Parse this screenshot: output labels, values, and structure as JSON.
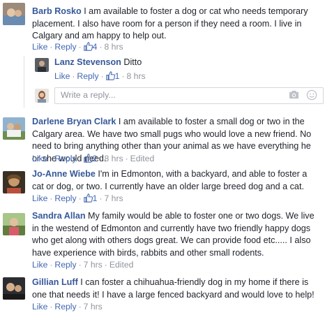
{
  "comments": [
    {
      "author": "Barb Rosko",
      "text": "I am available to foster a dog or cat who needs temporary placement. I also have room for a person if they need a room. I live in Calgary and am happy to help out.",
      "like_label": "Like",
      "reply_label": "Reply",
      "likes": "4",
      "time": "8 hrs",
      "edited": ""
    },
    {
      "author": "Darlene Bryan Clark",
      "text": "I am available to foster a small dog or two in the Calgary area. We have two small pugs who would love a new friend. No need to bring anything other than your animal as we have everything he or she would need.",
      "like_label": "Like",
      "reply_label": "Reply",
      "likes": "2",
      "time": "8 hrs",
      "edited": "Edited"
    },
    {
      "author": "Jo-Anne Wiebe",
      "text": "I'm in Edmonton, with a backyard, and able to foster a cat or dog, or two. I currently have an older large breed dog and a cat.",
      "like_label": "Like",
      "reply_label": "Reply",
      "likes": "1",
      "time": "7 hrs",
      "edited": ""
    },
    {
      "author": "Sandra Allan",
      "text": "My family would be able to foster one or two dogs. We live in the westend of Edmonton and currently have two friendly happy dogs who get along with others dogs great. We can provide food etc..... I also have experience with birds, rabbits and other small rodents.",
      "like_label": "Like",
      "reply_label": "Reply",
      "likes": "",
      "time": "7 hrs",
      "edited": "Edited"
    },
    {
      "author": "Gillian Luff",
      "text": "I can foster a chihuahua-friendly dog in my home if there is one that needs it! I have a large fenced backyard and would love to help!",
      "like_label": "Like",
      "reply_label": "Reply",
      "likes": "",
      "time": "7 hrs",
      "edited": ""
    }
  ],
  "reply": {
    "author": "Lanz Stevenson",
    "text": "Ditto",
    "like_label": "Like",
    "reply_label": "Reply",
    "likes": "1",
    "time": "8 hrs"
  },
  "reply_box": {
    "placeholder": "Write a reply..."
  },
  "icons": {
    "like": "thumbs-up-icon",
    "camera": "camera-icon",
    "emoji": "smiley-icon"
  },
  "colors": {
    "link": "#4267b2",
    "author": "#365899",
    "meta": "#90949c"
  }
}
